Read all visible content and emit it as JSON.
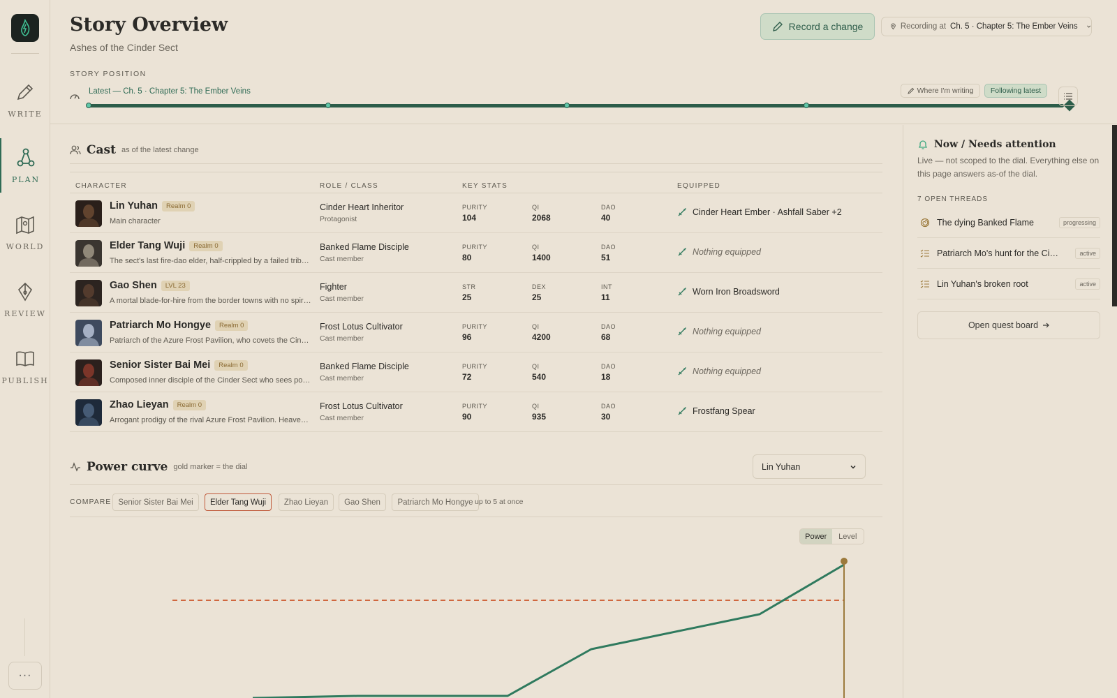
{
  "rail": {
    "items": [
      {
        "label": "WRITE"
      },
      {
        "label": "PLAN"
      },
      {
        "label": "WORLD"
      },
      {
        "label": "REVIEW"
      },
      {
        "label": "PUBLISH"
      }
    ],
    "active": "PLAN",
    "more": "···"
  },
  "header": {
    "title": "Story Overview",
    "subtitle": "Ashes of the Cinder Sect",
    "record_button": "Record a change",
    "recording_prefix": "Recording at",
    "recording_location": "Ch. 5 · Chapter 5: The Ember Veins"
  },
  "position": {
    "label": "STORY POSITION",
    "latest": "Latest — Ch. 5 · Chapter 5: The Ember Veins",
    "where_writing": "Where I'm writing",
    "following": "Following latest"
  },
  "cast": {
    "title": "Cast",
    "note": "as of the latest change",
    "columns": {
      "character": "CHARACTER",
      "role": "ROLE / CLASS",
      "stats": "KEY STATS",
      "equipped": "EQUIPPED"
    },
    "rows": [
      {
        "name": "Lin Yuhan",
        "badge": "Realm 0",
        "desc": "Main character",
        "role": "Cinder Heart Inheritor",
        "role_sub": "Protagonist",
        "stats": [
          {
            "k": "PURITY",
            "v": "104"
          },
          {
            "k": "QI",
            "v": "2068"
          },
          {
            "k": "DAO",
            "v": "40"
          }
        ],
        "equipped": "Cinder Heart Ember · Ashfall Saber +2",
        "equipped_empty": false
      },
      {
        "name": "Elder Tang Wuji",
        "badge": "Realm 0",
        "desc": "The sect's last fire-dao elder, half-crippled by a failed tribul...",
        "role": "Banked Flame Disciple",
        "role_sub": "Cast member",
        "stats": [
          {
            "k": "PURITY",
            "v": "80"
          },
          {
            "k": "QI",
            "v": "1400"
          },
          {
            "k": "DAO",
            "v": "51"
          }
        ],
        "equipped": "Nothing equipped",
        "equipped_empty": true
      },
      {
        "name": "Gao Shen",
        "badge": "LVL 23",
        "desc": "A mortal blade-for-hire from the border towns with no spirit...",
        "role": "Fighter",
        "role_sub": "Cast member",
        "stats": [
          {
            "k": "STR",
            "v": "25"
          },
          {
            "k": "DEX",
            "v": "25"
          },
          {
            "k": "INT",
            "v": "11"
          }
        ],
        "equipped": "Worn Iron Broadsword",
        "equipped_empty": false
      },
      {
        "name": "Patriarch Mo Hongye",
        "badge": "Realm 0",
        "desc": "Patriarch of the Azure Frost Pavilion, who covets the Cinder...",
        "role": "Frost Lotus Cultivator",
        "role_sub": "Cast member",
        "stats": [
          {
            "k": "PURITY",
            "v": "96"
          },
          {
            "k": "QI",
            "v": "4200"
          },
          {
            "k": "DAO",
            "v": "68"
          }
        ],
        "equipped": "Nothing equipped",
        "equipped_empty": true
      },
      {
        "name": "Senior Sister Bai Mei",
        "badge": "Realm 0",
        "desc": "Composed inner disciple of the Cinder Sect who sees pote...",
        "role": "Banked Flame Disciple",
        "role_sub": "Cast member",
        "stats": [
          {
            "k": "PURITY",
            "v": "72"
          },
          {
            "k": "QI",
            "v": "540"
          },
          {
            "k": "DAO",
            "v": "18"
          }
        ],
        "equipped": "Nothing equipped",
        "equipped_empty": true
      },
      {
        "name": "Zhao Lieyan",
        "badge": "Realm 0",
        "desc": "Arrogant prodigy of the rival Azure Frost Pavilion. Heaven-g...",
        "role": "Frost Lotus Cultivator",
        "role_sub": "Cast member",
        "stats": [
          {
            "k": "PURITY",
            "v": "90"
          },
          {
            "k": "QI",
            "v": "935"
          },
          {
            "k": "DAO",
            "v": "30"
          }
        ],
        "equipped": "Frostfang Spear",
        "equipped_empty": false
      }
    ]
  },
  "power": {
    "title": "Power curve",
    "note": "gold marker = the dial",
    "selected": "Lin Yuhan",
    "compare_label": "COMPARE",
    "compare": [
      {
        "label": "Senior Sister Bai Mei",
        "selected": false
      },
      {
        "label": "Elder Tang Wuji",
        "selected": true
      },
      {
        "label": "Zhao Lieyan",
        "selected": false
      },
      {
        "label": "Gao Shen",
        "selected": false
      },
      {
        "label": "Patriarch Mo Hongye",
        "selected": false
      }
    ],
    "limit_note": "up to 5 at once",
    "toggle": [
      "Power",
      "Level"
    ],
    "toggle_active": "Power"
  },
  "side": {
    "title": "Now / Needs attention",
    "desc": "Live — not scoped to the dial. Everything else on this page answers as-of the dial.",
    "threads_label": "7 OPEN THREADS",
    "threads": [
      {
        "name": "The dying Banked Flame",
        "status": "progressing"
      },
      {
        "name": "Patriarch Mo's hunt for the Cinder Heart",
        "status": "active"
      },
      {
        "name": "Lin Yuhan's broken root",
        "status": "active"
      }
    ],
    "quest_button": "Open quest board"
  },
  "colors": {
    "accent": "#2f6b55",
    "dial": "#9c7a3c",
    "compare_line": "#d0673f"
  }
}
